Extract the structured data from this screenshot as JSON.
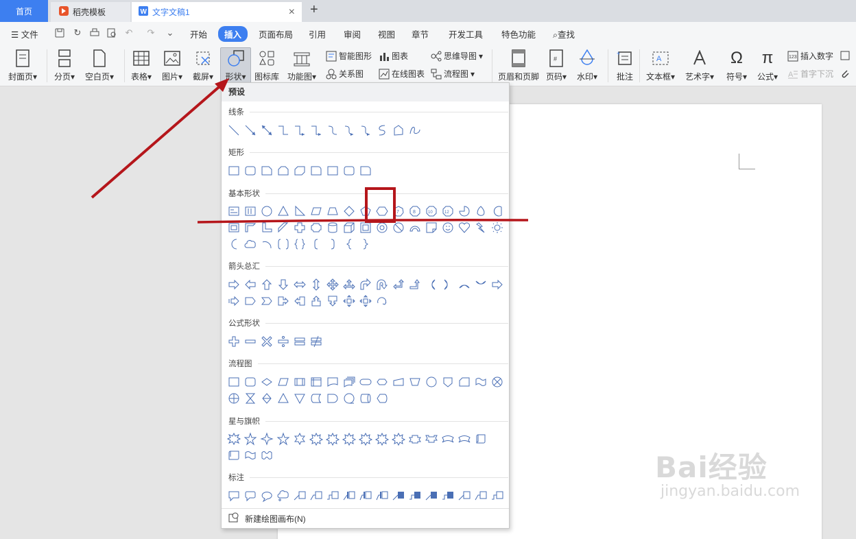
{
  "tabs": {
    "home": "首页",
    "template": "稻壳模板",
    "document": "文字文稿1"
  },
  "menu": {
    "file": "文件",
    "items": [
      "开始",
      "插入",
      "页面布局",
      "引用",
      "审阅",
      "视图",
      "章节",
      "开发工具",
      "特色功能"
    ],
    "search": "查找"
  },
  "ribbon": {
    "big": [
      "封面页",
      "分页",
      "空白页",
      "表格",
      "图片",
      "截屏",
      "形状",
      "图标库",
      "功能图",
      "页眉和页脚",
      "页码",
      "水印",
      "批注",
      "文本框",
      "艺术字",
      "符号",
      "公式"
    ],
    "small": [
      "智能图形",
      "图表",
      "思维导图",
      "关系图",
      "在线图表",
      "流程图",
      "插入数字",
      "首字下沉"
    ]
  },
  "panel": {
    "header": "预设",
    "categories": [
      "线条",
      "矩形",
      "基本形状",
      "箭头总汇",
      "公式形状",
      "流程图",
      "星与旗帜",
      "标注"
    ],
    "canvas_item": "新建绘图画布(N)"
  },
  "watermark": {
    "logo": "Bai经验",
    "sub": "jingyan.baidu.com"
  },
  "colors": {
    "accent": "#3d7ff0",
    "annotation": "#b5161b",
    "shape_stroke": "#4a6fb5"
  }
}
